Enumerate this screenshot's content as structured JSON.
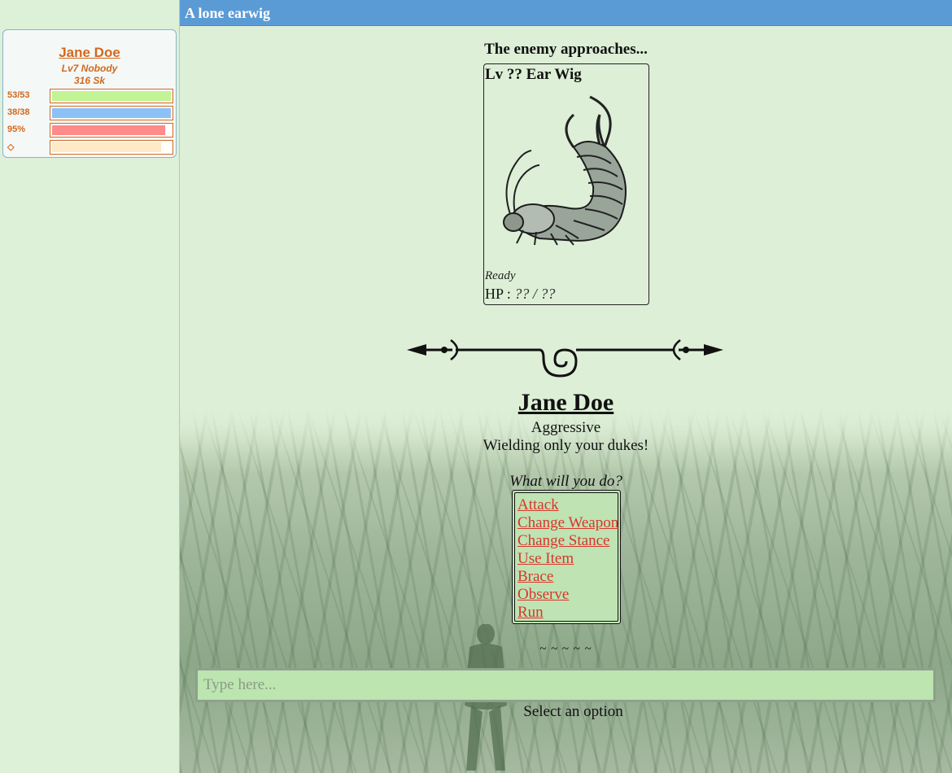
{
  "header": {
    "title": "A lone earwig"
  },
  "player": {
    "name": "Jane Doe",
    "class_line": "Lv7 Nobody",
    "currency": "316 Sk",
    "stats": [
      {
        "label": "53/53",
        "fill": 1.0,
        "color": "#c2f394",
        "kind": "health"
      },
      {
        "label": "38/38",
        "fill": 1.0,
        "color": "#8cc1f6",
        "kind": "mana"
      },
      {
        "label": "95%",
        "fill": 0.95,
        "color": "#ff8a8a",
        "kind": "stamina"
      },
      {
        "label": "◇",
        "fill": 0.92,
        "color": "#ffe9c6",
        "kind": "experience"
      }
    ]
  },
  "battle": {
    "enemy_approach": "The enemy approaches...",
    "enemy": {
      "name": "Lv ?? Ear Wig",
      "status": "Ready",
      "hp_label": "HP : ",
      "hp_value": "?? / ??"
    },
    "character": {
      "name": "Jane Doe",
      "stance": "Aggressive",
      "weapon": "Wielding only your dukes!"
    },
    "prompt": "What will you do?",
    "menu": [
      "Attack",
      "Change Weapon",
      "Change Stance",
      "Use Item",
      "Brace",
      "Observe",
      "Run"
    ],
    "separator": "~ ~ ~ ~ ~"
  },
  "input": {
    "placeholder": "Type here..."
  },
  "status_text": "Select an option",
  "colors": {
    "header_bg": "#5b9bd5",
    "name_accent": "#d2691e",
    "menu_link": "#d9362b",
    "menu_bg": "#bfe3b3",
    "input_bg": "#bce5b0"
  }
}
